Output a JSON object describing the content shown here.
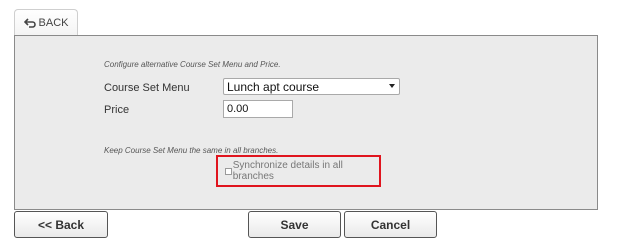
{
  "top_nav": {
    "back_label": "BACK"
  },
  "form": {
    "description_alt": "Configure alternative Course Set Menu and Price.",
    "course_set_menu_label": "Course Set Menu",
    "course_set_menu_value": "Lunch apt course",
    "price_label": "Price",
    "price_value": "0.00",
    "description_same": "Keep Course Set Menu the same in all branches.",
    "sync_label": "Synchronize details in all branches",
    "sync_checked": false
  },
  "footer": {
    "back_label": "<< Back",
    "save_label": "Save",
    "cancel_label": "Cancel"
  },
  "colors": {
    "highlight": "#e0141e",
    "panel_bg": "#ebebeb"
  }
}
